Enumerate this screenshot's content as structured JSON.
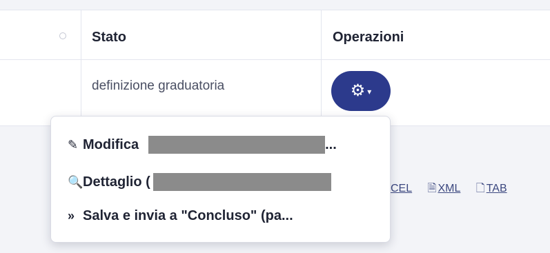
{
  "table": {
    "headers": {
      "stato": "Stato",
      "operazioni": "Operazioni"
    },
    "rows": [
      {
        "stato": "definizione graduatoria"
      }
    ]
  },
  "operations_button": {
    "icon": "gear-icon",
    "caret": "chevron-down-icon"
  },
  "dropdown": {
    "items": [
      {
        "icon": "pencil-icon",
        "label_prefix": "Modifica",
        "label_suffix": "..."
      },
      {
        "icon": "magnifier-icon",
        "label_prefix": "Dettaglio (",
        "label_suffix": ""
      },
      {
        "icon": "double-chevron-right-icon",
        "label_prefix": "Salva e invia a \"Concluso\" (pa...",
        "label_suffix": ""
      }
    ]
  },
  "export_links": {
    "excel": "CEL",
    "xml": "XML",
    "tab": "TAB"
  },
  "colors": {
    "accent": "#2c3a8c",
    "background": "#f3f4f8",
    "redaction": "#8b8b8b"
  }
}
